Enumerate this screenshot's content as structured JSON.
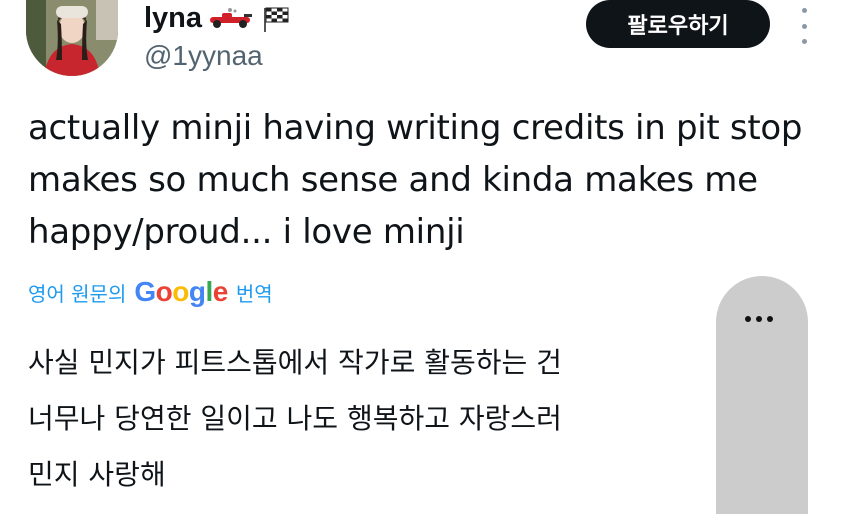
{
  "user": {
    "display_name": "lyna",
    "handle": "@1yynaa",
    "name_emoji": [
      "racing-car-icon",
      "chequered-flag-icon"
    ]
  },
  "actions": {
    "follow_label": "팔로우하기",
    "more_icon": "more-vertical-icon",
    "overlay_icon": "more-horizontal-icon"
  },
  "tweet": {
    "text": "actually minji having writing credits in pit stop makes so much sense and kinda makes me happy/proud... i love minji"
  },
  "translation": {
    "prefix": "영어 원문의",
    "provider": "Google",
    "suffix": "번역",
    "lines": [
      "사실 민지가 피트스톱에서 작가로 활동하는 건",
      "너무나 당연한 일이고 나도 행복하고 자랑스러",
      "민지 사랑해"
    ]
  },
  "colors": {
    "text": "#0f1419",
    "secondary": "#536471",
    "link": "#1d9bf0",
    "button_bg": "#0f1419",
    "button_fg": "#ffffff"
  }
}
